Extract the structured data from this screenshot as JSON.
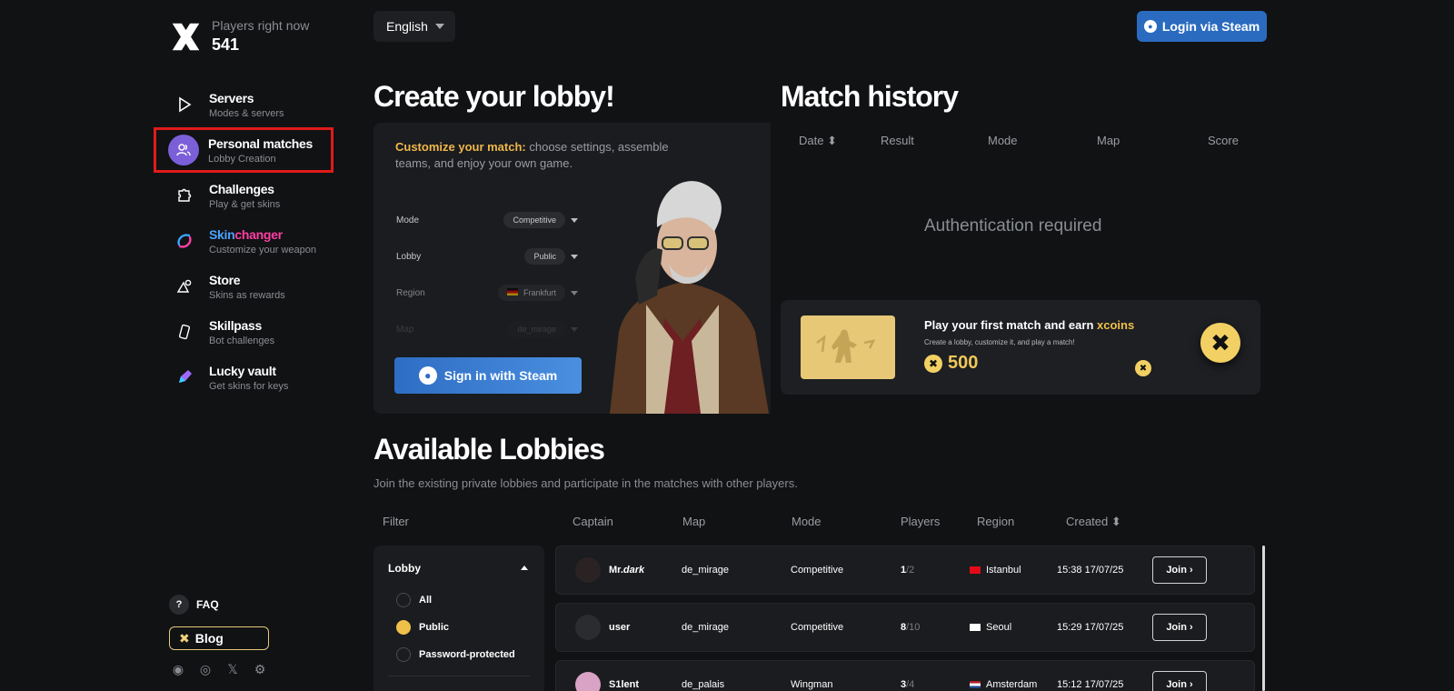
{
  "brand": {
    "online_label": "Players right now",
    "online_count": "541"
  },
  "nav": [
    {
      "title": "Servers",
      "sub": "Modes & servers",
      "icon": "play-icon"
    },
    {
      "title": "Personal matches",
      "sub": "Lobby Creation",
      "icon": "users-icon"
    },
    {
      "title": "Challenges",
      "sub": "Play & get skins",
      "icon": "puzzle-icon"
    },
    {
      "title": "Skinchanger",
      "title_a": "Skin",
      "title_b": "changer",
      "sub": "Customize your weapon",
      "icon": "skinchanger-icon"
    },
    {
      "title": "Store",
      "sub": "Skins as rewards",
      "icon": "shapes-icon"
    },
    {
      "title": "Skillpass",
      "sub": "Bot challenges",
      "icon": "card-icon"
    },
    {
      "title": "Lucky vault",
      "sub": "Get skins for keys",
      "icon": "key-icon"
    }
  ],
  "footer": {
    "faq": "FAQ",
    "faq_icon": "?",
    "blog": "Blog"
  },
  "topbar": {
    "language": "English",
    "login": "Login via Steam"
  },
  "create": {
    "heading": "Create your lobby!",
    "intro_hl": "Customize your match:",
    "intro_rest": " choose settings, assemble teams, and enjoy your own game.",
    "fields": [
      {
        "label": "Mode",
        "value": "Competitive"
      },
      {
        "label": "Lobby",
        "value": "Public"
      },
      {
        "label": "Region",
        "value": "Frankfurt"
      },
      {
        "label": "Map",
        "value": "de_mirage"
      }
    ],
    "signin": "Sign in with Steam"
  },
  "history": {
    "heading": "Match history",
    "columns": [
      "Date",
      "Result",
      "Mode",
      "Map",
      "Score"
    ],
    "empty": "Authentication required"
  },
  "promo": {
    "title_a": "Play your first match and earn ",
    "title_b": "xcoins",
    "sub": "Create a lobby, customize it, and play a match!",
    "amount": "500"
  },
  "lobbies": {
    "heading": "Available Lobbies",
    "sub": "Join the existing private lobbies and participate in the matches with other players.",
    "filter_label": "Filter",
    "columns": [
      "Captain",
      "Map",
      "Mode",
      "Players",
      "Region",
      "Created"
    ],
    "filter": {
      "title": "Lobby",
      "options": [
        {
          "label": "All",
          "checked": false
        },
        {
          "label": "Public",
          "checked": true
        },
        {
          "label": "Password-protected",
          "checked": false
        }
      ]
    },
    "rows": [
      {
        "captain_a": "Mr.",
        "captain_b": "dark",
        "map": "de_mirage",
        "mode": "Competitive",
        "players": "1",
        "max": "/2",
        "region": "Istanbul",
        "created": "15:38 17/07/25",
        "join": "Join"
      },
      {
        "captain_a": "user",
        "captain_b": "",
        "map": "de_mirage",
        "mode": "Competitive",
        "players": "8",
        "max": "/10",
        "region": "Seoul",
        "created": "15:29 17/07/25",
        "join": "Join"
      },
      {
        "captain_a": "S1lent",
        "captain_b": "",
        "map": "de_palais",
        "mode": "Wingman",
        "players": "3",
        "max": "/4",
        "region": "Amsterdam",
        "created": "15:12 17/07/25",
        "join": "Join"
      }
    ]
  },
  "colors": {
    "accent_gold": "#f0c049",
    "steam_blue": "#2a6bbf",
    "active_nav": "#7b5fd9",
    "highlight_red": "#e01b1b"
  }
}
